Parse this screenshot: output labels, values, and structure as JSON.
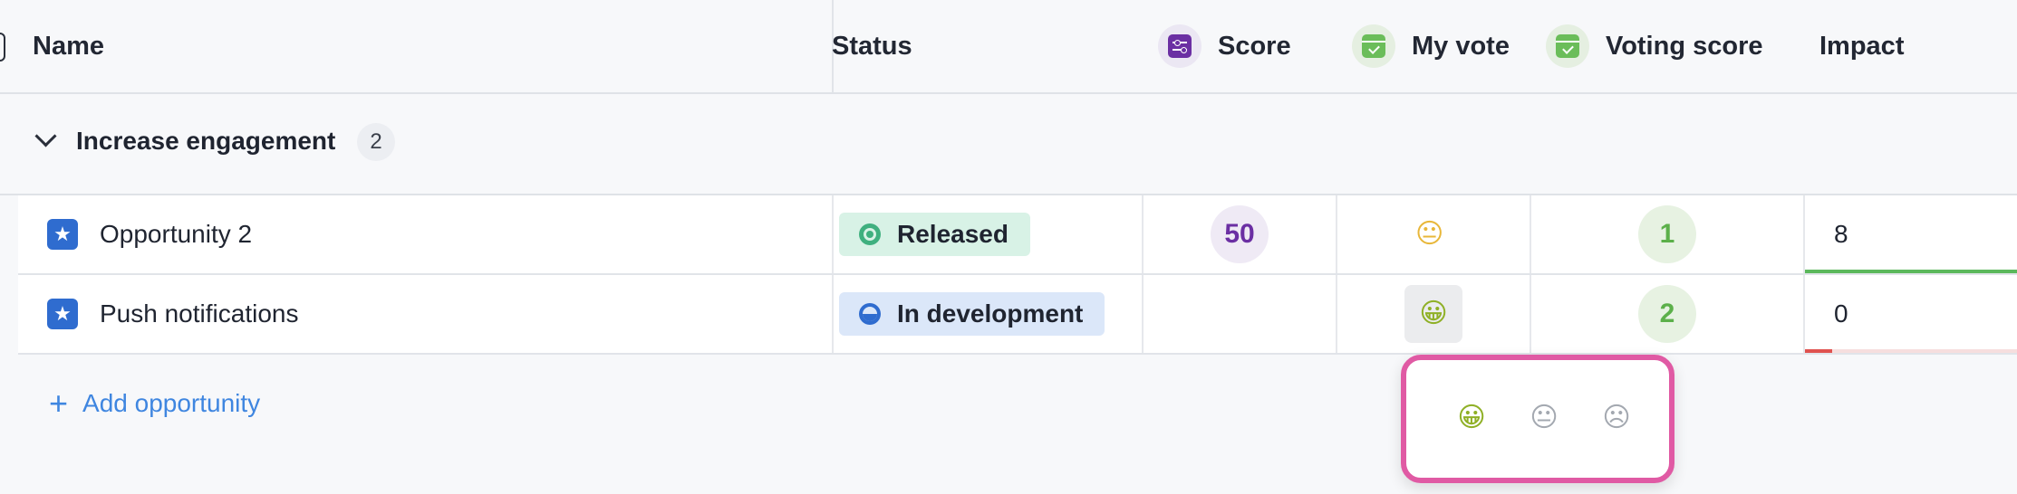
{
  "header": {
    "name": "Name",
    "status": "Status",
    "score": "Score",
    "my_vote": "My vote",
    "voting_score": "Voting score",
    "impact": "Impact"
  },
  "group": {
    "title": "Increase engagement",
    "count": "2"
  },
  "rows": [
    {
      "name": "Opportunity 2",
      "status": "Released",
      "score": "50",
      "my_vote_icon": "neutral-face-icon",
      "voting_score": "1",
      "impact": "8",
      "impact_fraction": 1.0,
      "impact_color": "#5cb85c"
    },
    {
      "name": "Push notifications",
      "status": "In development",
      "score": "",
      "my_vote_icon": "grinning-face-icon",
      "voting_score": "2",
      "impact": "0",
      "impact_fraction": 0.0,
      "impact_color": "#e0524f"
    }
  ],
  "add": {
    "label": "Add opportunity"
  },
  "vote_popover": {
    "options": [
      "grinning-face-icon",
      "neutral-face-icon",
      "sad-face-icon"
    ]
  },
  "colors": {
    "accent_blue": "#3f86e0",
    "score_purple": "#6b2fa3",
    "vote_green": "#5cb04a",
    "popover_border": "#e05aa4"
  }
}
